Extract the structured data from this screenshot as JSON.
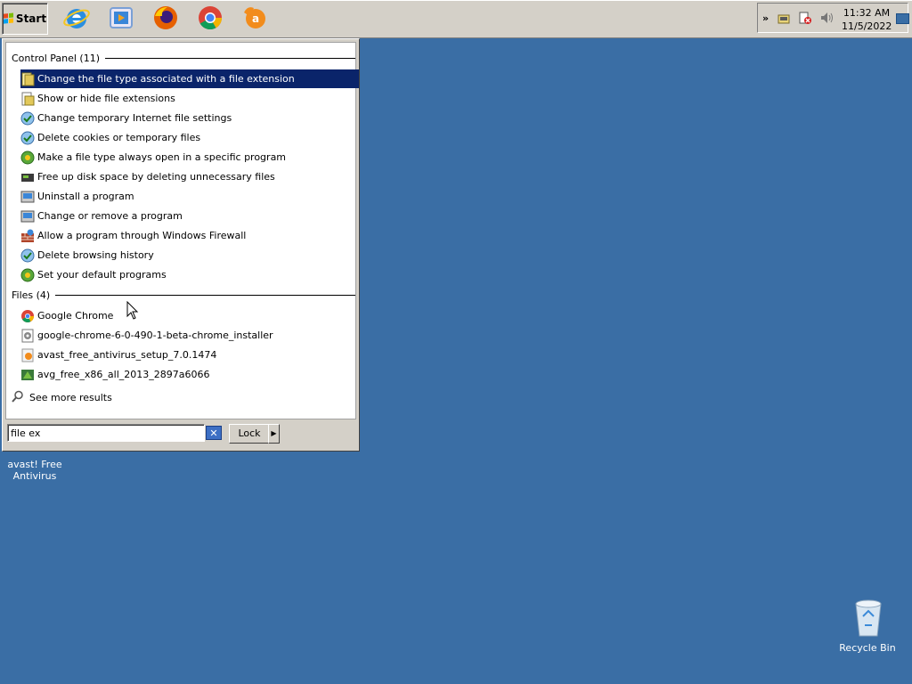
{
  "taskbar": {
    "start_label": "Start",
    "quick_launch": [
      "internet-explorer-icon",
      "media-player-icon",
      "firefox-icon",
      "chrome-icon",
      "avast-icon"
    ],
    "clock_time": "11:32 AM",
    "clock_date": "11/5/2022"
  },
  "search_panel": {
    "control_panel_header": "Control Panel (11)",
    "control_panel_items": [
      "Change the file type associated with a file extension",
      "Show or hide file extensions",
      "Change temporary Internet file settings",
      "Delete cookies or temporary files",
      "Make a file type always open in a specific program",
      "Free up disk space by deleting unnecessary files",
      "Uninstall a program",
      "Change or remove a program",
      "Allow a program through Windows Firewall",
      "Delete browsing history",
      "Set your default programs"
    ],
    "files_header": "Files (4)",
    "file_items": [
      "Google Chrome",
      "google-chrome-6-0-490-1-beta-chrome_installer",
      "avast_free_antivirus_setup_7.0.1474",
      "avg_free_x86_all_2013_2897a6066"
    ],
    "see_more": "See more results",
    "search_value": "file ex",
    "lock_label": "Lock"
  },
  "desktop": {
    "avast_label_line1": "avast! Free",
    "avast_label_line2": "Antivirus",
    "recycle_bin_label": "Recycle Bin"
  },
  "colors": {
    "desktop": "#3a6ea5",
    "selection": "#0a246a",
    "taskbar": "#d4d0c8"
  }
}
